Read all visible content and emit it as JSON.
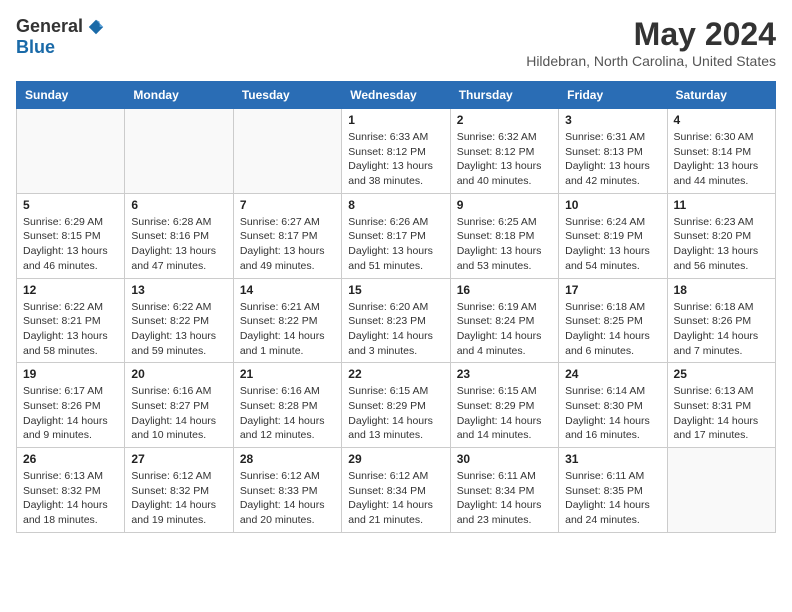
{
  "header": {
    "logo_general": "General",
    "logo_blue": "Blue",
    "month_year": "May 2024",
    "location": "Hildebran, North Carolina, United States"
  },
  "days_of_week": [
    "Sunday",
    "Monday",
    "Tuesday",
    "Wednesday",
    "Thursday",
    "Friday",
    "Saturday"
  ],
  "weeks": [
    [
      {
        "day": "",
        "info": ""
      },
      {
        "day": "",
        "info": ""
      },
      {
        "day": "",
        "info": ""
      },
      {
        "day": "1",
        "info": "Sunrise: 6:33 AM\nSunset: 8:12 PM\nDaylight: 13 hours\nand 38 minutes."
      },
      {
        "day": "2",
        "info": "Sunrise: 6:32 AM\nSunset: 8:12 PM\nDaylight: 13 hours\nand 40 minutes."
      },
      {
        "day": "3",
        "info": "Sunrise: 6:31 AM\nSunset: 8:13 PM\nDaylight: 13 hours\nand 42 minutes."
      },
      {
        "day": "4",
        "info": "Sunrise: 6:30 AM\nSunset: 8:14 PM\nDaylight: 13 hours\nand 44 minutes."
      }
    ],
    [
      {
        "day": "5",
        "info": "Sunrise: 6:29 AM\nSunset: 8:15 PM\nDaylight: 13 hours\nand 46 minutes."
      },
      {
        "day": "6",
        "info": "Sunrise: 6:28 AM\nSunset: 8:16 PM\nDaylight: 13 hours\nand 47 minutes."
      },
      {
        "day": "7",
        "info": "Sunrise: 6:27 AM\nSunset: 8:17 PM\nDaylight: 13 hours\nand 49 minutes."
      },
      {
        "day": "8",
        "info": "Sunrise: 6:26 AM\nSunset: 8:17 PM\nDaylight: 13 hours\nand 51 minutes."
      },
      {
        "day": "9",
        "info": "Sunrise: 6:25 AM\nSunset: 8:18 PM\nDaylight: 13 hours\nand 53 minutes."
      },
      {
        "day": "10",
        "info": "Sunrise: 6:24 AM\nSunset: 8:19 PM\nDaylight: 13 hours\nand 54 minutes."
      },
      {
        "day": "11",
        "info": "Sunrise: 6:23 AM\nSunset: 8:20 PM\nDaylight: 13 hours\nand 56 minutes."
      }
    ],
    [
      {
        "day": "12",
        "info": "Sunrise: 6:22 AM\nSunset: 8:21 PM\nDaylight: 13 hours\nand 58 minutes."
      },
      {
        "day": "13",
        "info": "Sunrise: 6:22 AM\nSunset: 8:22 PM\nDaylight: 13 hours\nand 59 minutes."
      },
      {
        "day": "14",
        "info": "Sunrise: 6:21 AM\nSunset: 8:22 PM\nDaylight: 14 hours\nand 1 minute."
      },
      {
        "day": "15",
        "info": "Sunrise: 6:20 AM\nSunset: 8:23 PM\nDaylight: 14 hours\nand 3 minutes."
      },
      {
        "day": "16",
        "info": "Sunrise: 6:19 AM\nSunset: 8:24 PM\nDaylight: 14 hours\nand 4 minutes."
      },
      {
        "day": "17",
        "info": "Sunrise: 6:18 AM\nSunset: 8:25 PM\nDaylight: 14 hours\nand 6 minutes."
      },
      {
        "day": "18",
        "info": "Sunrise: 6:18 AM\nSunset: 8:26 PM\nDaylight: 14 hours\nand 7 minutes."
      }
    ],
    [
      {
        "day": "19",
        "info": "Sunrise: 6:17 AM\nSunset: 8:26 PM\nDaylight: 14 hours\nand 9 minutes."
      },
      {
        "day": "20",
        "info": "Sunrise: 6:16 AM\nSunset: 8:27 PM\nDaylight: 14 hours\nand 10 minutes."
      },
      {
        "day": "21",
        "info": "Sunrise: 6:16 AM\nSunset: 8:28 PM\nDaylight: 14 hours\nand 12 minutes."
      },
      {
        "day": "22",
        "info": "Sunrise: 6:15 AM\nSunset: 8:29 PM\nDaylight: 14 hours\nand 13 minutes."
      },
      {
        "day": "23",
        "info": "Sunrise: 6:15 AM\nSunset: 8:29 PM\nDaylight: 14 hours\nand 14 minutes."
      },
      {
        "day": "24",
        "info": "Sunrise: 6:14 AM\nSunset: 8:30 PM\nDaylight: 14 hours\nand 16 minutes."
      },
      {
        "day": "25",
        "info": "Sunrise: 6:13 AM\nSunset: 8:31 PM\nDaylight: 14 hours\nand 17 minutes."
      }
    ],
    [
      {
        "day": "26",
        "info": "Sunrise: 6:13 AM\nSunset: 8:32 PM\nDaylight: 14 hours\nand 18 minutes."
      },
      {
        "day": "27",
        "info": "Sunrise: 6:12 AM\nSunset: 8:32 PM\nDaylight: 14 hours\nand 19 minutes."
      },
      {
        "day": "28",
        "info": "Sunrise: 6:12 AM\nSunset: 8:33 PM\nDaylight: 14 hours\nand 20 minutes."
      },
      {
        "day": "29",
        "info": "Sunrise: 6:12 AM\nSunset: 8:34 PM\nDaylight: 14 hours\nand 21 minutes."
      },
      {
        "day": "30",
        "info": "Sunrise: 6:11 AM\nSunset: 8:34 PM\nDaylight: 14 hours\nand 23 minutes."
      },
      {
        "day": "31",
        "info": "Sunrise: 6:11 AM\nSunset: 8:35 PM\nDaylight: 14 hours\nand 24 minutes."
      },
      {
        "day": "",
        "info": ""
      }
    ]
  ]
}
